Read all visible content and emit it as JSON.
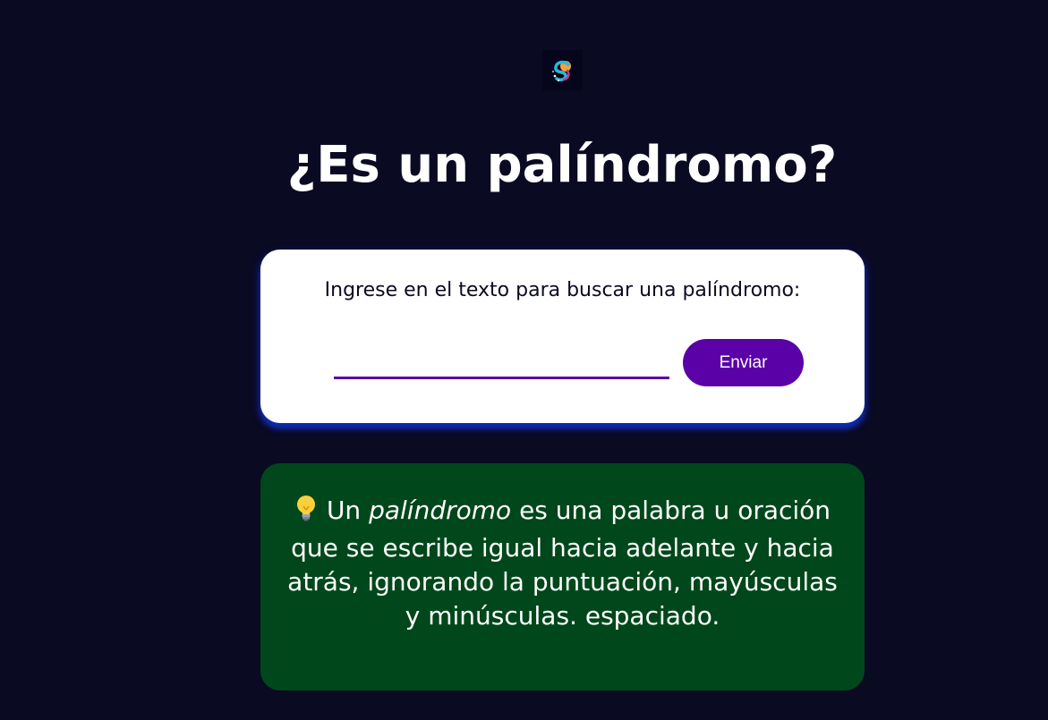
{
  "logo": {
    "icon": "freecodecamp-style-logo-icon"
  },
  "title": "¿Es un palíndromo?",
  "form": {
    "label": "Ingrese en el texto para buscar una palíndromo:",
    "input_value": "",
    "input_placeholder": "",
    "submit_label": "Enviar"
  },
  "info": {
    "icon": "lightbulb-icon",
    "intro": "Un",
    "term": "palíndromo",
    "rest": "es una palabra u oración que se escribe igual hacia adelante y hacia atrás, ignorando la puntuación, mayúsculas y minúsculas. espaciado."
  },
  "colors": {
    "background": "#0a0a23",
    "accent": "#5a01a7",
    "info_background": "#00471b",
    "card_background": "#ffffff"
  }
}
